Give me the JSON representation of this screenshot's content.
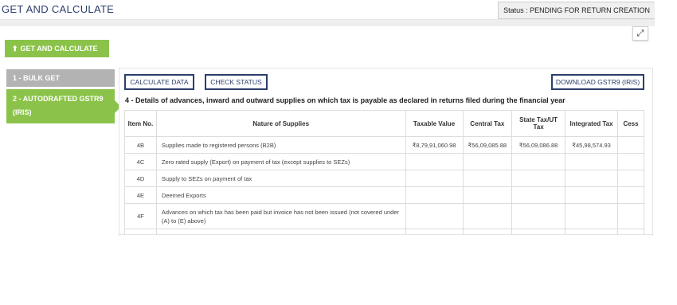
{
  "header": {
    "title": "GET AND CALCULATE",
    "status": "Status : PENDING FOR RETURN CREATION"
  },
  "actions": {
    "get_and_calculate": "GET AND CALCULATE",
    "calculate_data": "CALCULATE DATA",
    "check_status": "CHECK STATUS",
    "download": "DOWNLOAD GSTR9 (IRIS)"
  },
  "steps": [
    {
      "label": "1 - BULK GET"
    },
    {
      "label": "2 - AUTODRAFTED GSTR9 (IRIS)"
    }
  ],
  "section": {
    "title": "4 - Details of advances, inward and outward supplies on which tax is payable as declared in returns filed during the financial year"
  },
  "table": {
    "headers": [
      "Item No.",
      "Nature of Supplies",
      "Taxable Value",
      "Central Tax",
      "State Tax/UT Tax",
      "Integrated Tax",
      "Cess"
    ],
    "rows": [
      {
        "item": "4B",
        "nature": "Supplies made to registered persons (B2B)",
        "taxable": "₹8,79,91,060.98",
        "central": "₹56,09,085.88",
        "state": "₹56,09,086.88",
        "integrated": "₹45,98,574.93",
        "cess": ""
      },
      {
        "item": "4C",
        "nature": "Zero rated supply (Export) on payment of tax (except supplies to SEZs)",
        "taxable": "",
        "central": "",
        "state": "",
        "integrated": "",
        "cess": ""
      },
      {
        "item": "4D",
        "nature": "Supply to SEZs on payment of tax",
        "taxable": "",
        "central": "",
        "state": "",
        "integrated": "",
        "cess": ""
      },
      {
        "item": "4E",
        "nature": "Deemed Exports",
        "taxable": "",
        "central": "",
        "state": "",
        "integrated": "",
        "cess": ""
      },
      {
        "item": "4F",
        "nature": "Advances on which tax has been paid but invoice has not been issued (not covered under (A) to (E) above)",
        "taxable": "",
        "central": "",
        "state": "",
        "integrated": "",
        "cess": ""
      }
    ]
  },
  "icons": {
    "upload": "upload-icon",
    "expand": "expand-icon"
  },
  "colors": {
    "accent_green": "#8bc34a",
    "navy": "#2c3e6b",
    "inactive_grey": "#b3b3b3"
  }
}
